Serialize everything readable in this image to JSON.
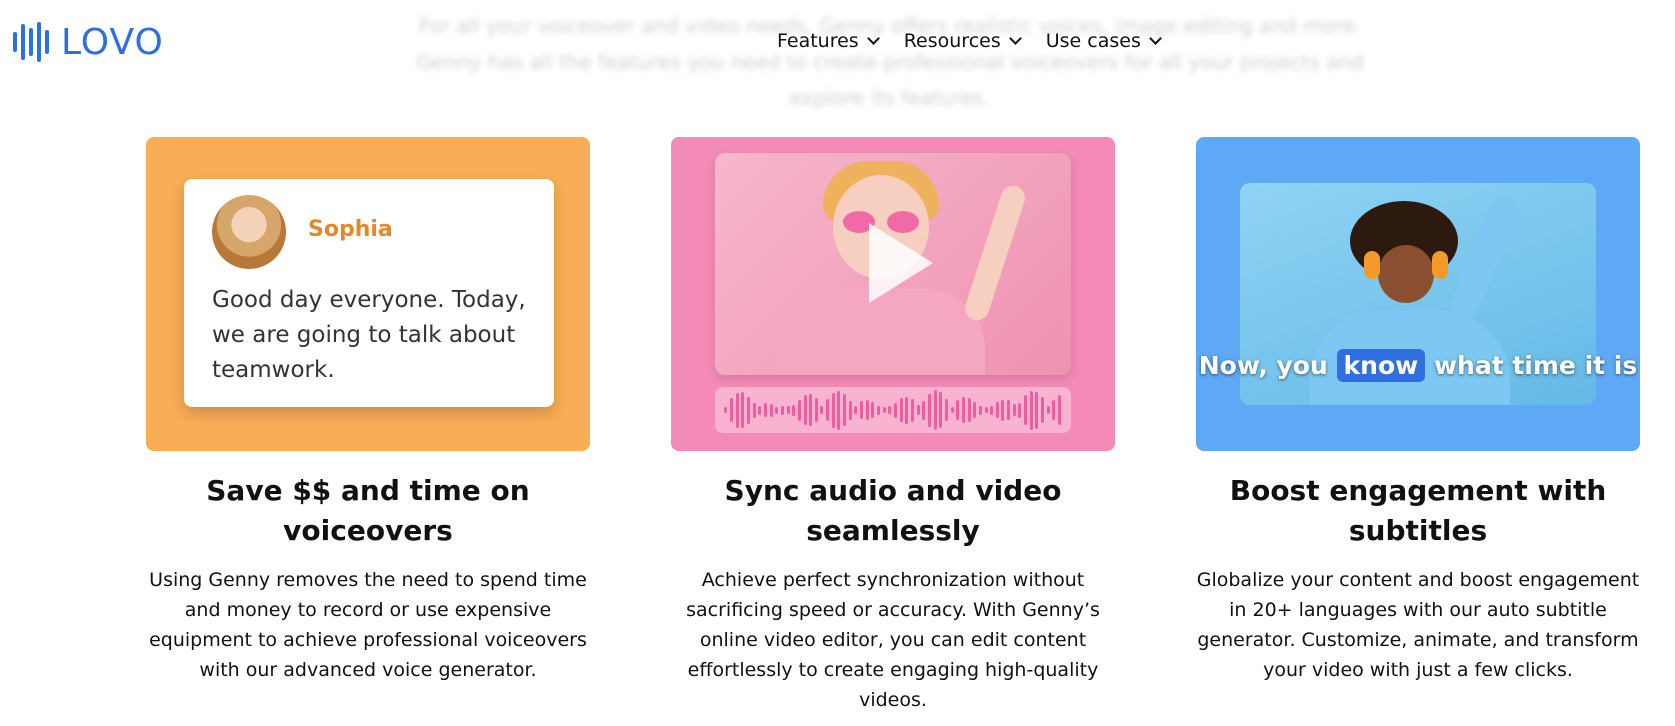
{
  "background_text": "For all your voiceover and video needs, Genny offers realistic voices, image editing and more. Genny has all the features you need to create professional voiceovers for all your projects and explore its features.",
  "brand": {
    "name": "LOVO",
    "color": "#2f6fde"
  },
  "nav": {
    "items": [
      {
        "label": "Features"
      },
      {
        "label": "Resources"
      },
      {
        "label": "Use cases"
      }
    ]
  },
  "cards": [
    {
      "color": "#f8ad56",
      "art": {
        "speaker_name": "Sophia",
        "speech_text": "Good day everyone. Today, we are going to talk about teamwork."
      },
      "title": "Save $$ and time on voiceovers",
      "description": "Using Genny removes the need to spend time and money to record or use expensive equipment to achieve professional voiceovers with our advanced voice generator."
    },
    {
      "color": "#f48ab6",
      "title": "Sync audio and video seamlessly",
      "description": "Achieve perfect synchronization without sacrificing speed or accuracy. With Genny’s online video editor, you can edit content effortlessly to create engaging high-quality videos."
    },
    {
      "color": "#5ea8f6",
      "art": {
        "subtitle_before": "Now, you",
        "subtitle_highlight": "know",
        "subtitle_after": "what time it is"
      },
      "title": "Boost engagement with subtitles",
      "description": "Globalize your content and boost engagement in 20+ languages with our auto subtitle generator. Customize, animate, and transform your video with just a few clicks."
    }
  ],
  "icons": {
    "logo": "lovo-waveform-logo-icon",
    "dropdown": "chevron-down-icon",
    "play": "play-icon"
  }
}
